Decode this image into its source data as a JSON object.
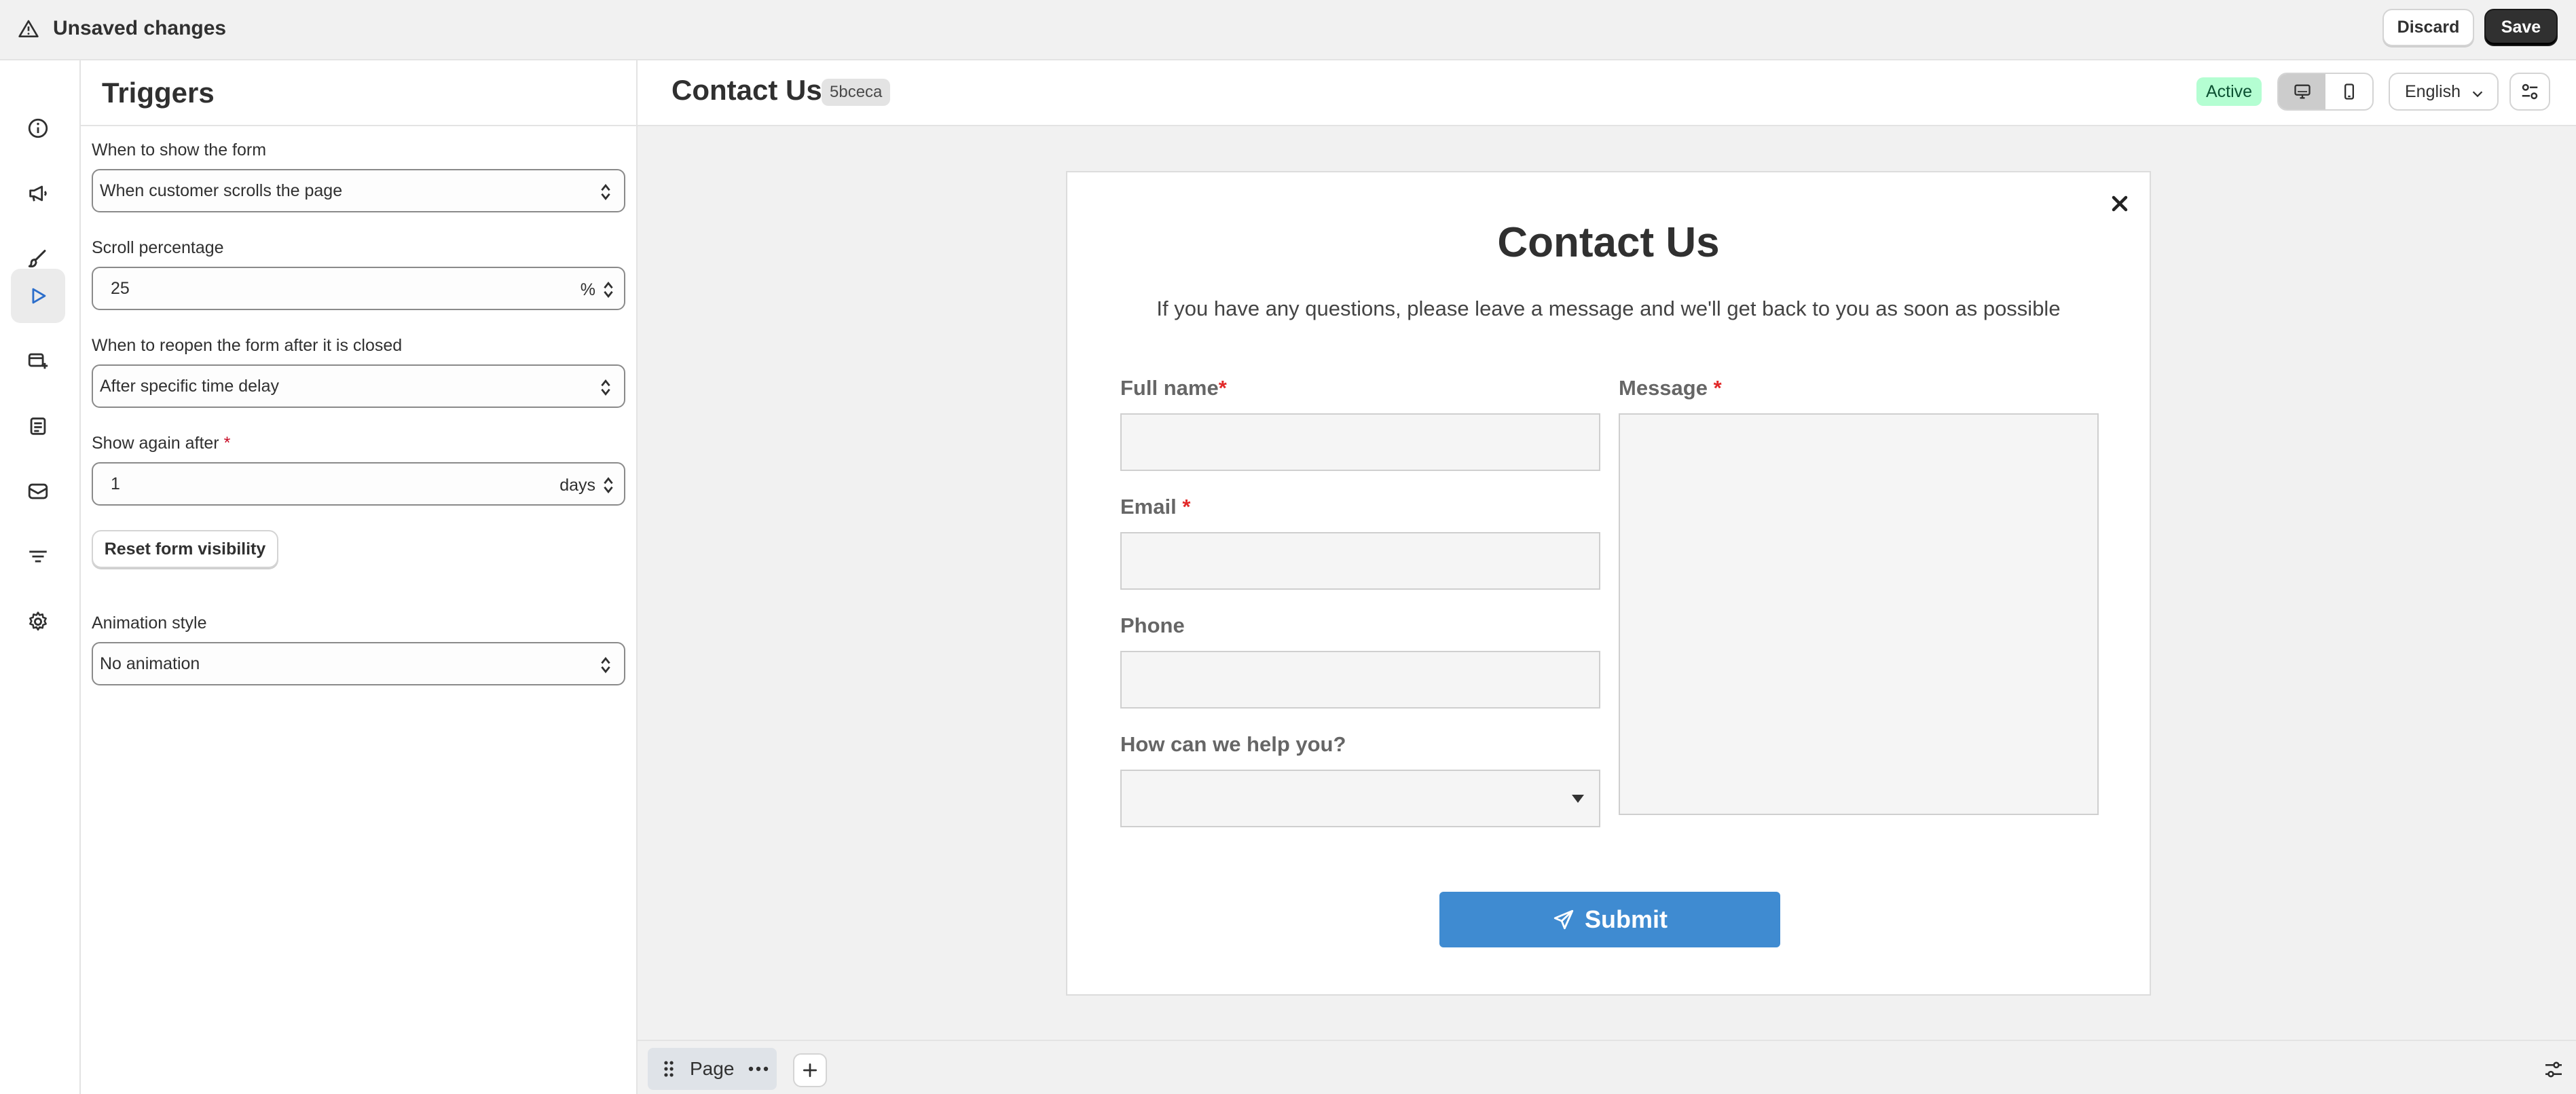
{
  "topbar": {
    "title": "Unsaved changes",
    "discard_label": "Discard",
    "save_label": "Save"
  },
  "rail": {
    "items": [
      "info-icon",
      "megaphone-icon",
      "brush-icon",
      "play-icon",
      "form-icon",
      "report-icon",
      "mail-icon",
      "filter-icon",
      "gear-icon"
    ],
    "active": "play-icon"
  },
  "panel": {
    "title": "Triggers",
    "show_label": "When to show the form",
    "show_value": "When customer scrolls the page",
    "scroll_label": "Scroll percentage",
    "scroll_value": "25",
    "scroll_suffix": "%",
    "reopen_label": "When to reopen the form after it is closed",
    "reopen_value": "After specific time delay",
    "show_again_label": "Show again after",
    "show_again_value": "1",
    "show_again_suffix": "days",
    "reset_label": "Reset form visibility",
    "animation_label": "Animation style",
    "animation_value": "No animation"
  },
  "preview_header": {
    "title": "Contact Us",
    "id": "5bceca",
    "status": "Active",
    "language": "English"
  },
  "form": {
    "title": "Contact Us",
    "subtitle": "If you have any questions, please leave a message and we'll get back to you as soon as possible",
    "full_name": "Full name",
    "email": "Email",
    "phone": "Phone",
    "help": "How can we help you?",
    "message": "Message",
    "submit": "Submit"
  },
  "bottom": {
    "page_label": "Page"
  },
  "colors": {
    "accent_submit": "#3f8bd1",
    "active_badge_bg": "#b4fed2",
    "required": "#e22a2a"
  }
}
